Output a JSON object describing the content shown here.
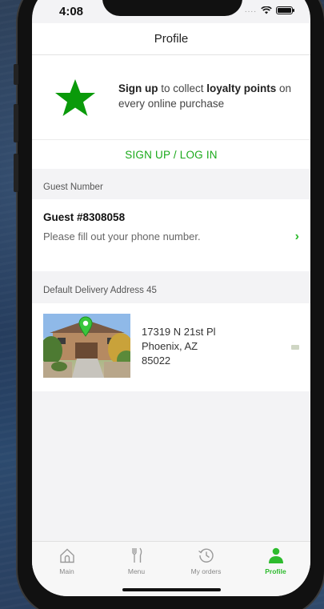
{
  "status_bar": {
    "time": "4:08",
    "signal_dots": "...."
  },
  "header": {
    "title": "Profile"
  },
  "promo": {
    "sign_up_bold": "Sign up",
    "text_mid": " to collect ",
    "loyalty_bold": "loyalty points",
    "text_end": " on every online purchase"
  },
  "signup_link": {
    "label": "SIGN UP / LOG IN"
  },
  "guest_section": {
    "label": "Guest Number",
    "title": "Guest #8308058",
    "subtitle": "Please fill out your phone number.",
    "chevron": "›"
  },
  "address_section": {
    "label": "Default Delivery Address 45",
    "line1": "17319 N 21st Pl",
    "line2": "Phoenix, AZ",
    "line3": "85022"
  },
  "tabs": [
    {
      "label": "Main",
      "icon": "home-icon",
      "active": false
    },
    {
      "label": "Menu",
      "icon": "fork-knife-icon",
      "active": false
    },
    {
      "label": "My orders",
      "icon": "history-clock-icon",
      "active": false
    },
    {
      "label": "Profile",
      "icon": "person-icon",
      "active": true
    }
  ],
  "colors": {
    "accent": "#2dbb2d",
    "star": "#0a9a0a",
    "link": "#1aa91a"
  }
}
